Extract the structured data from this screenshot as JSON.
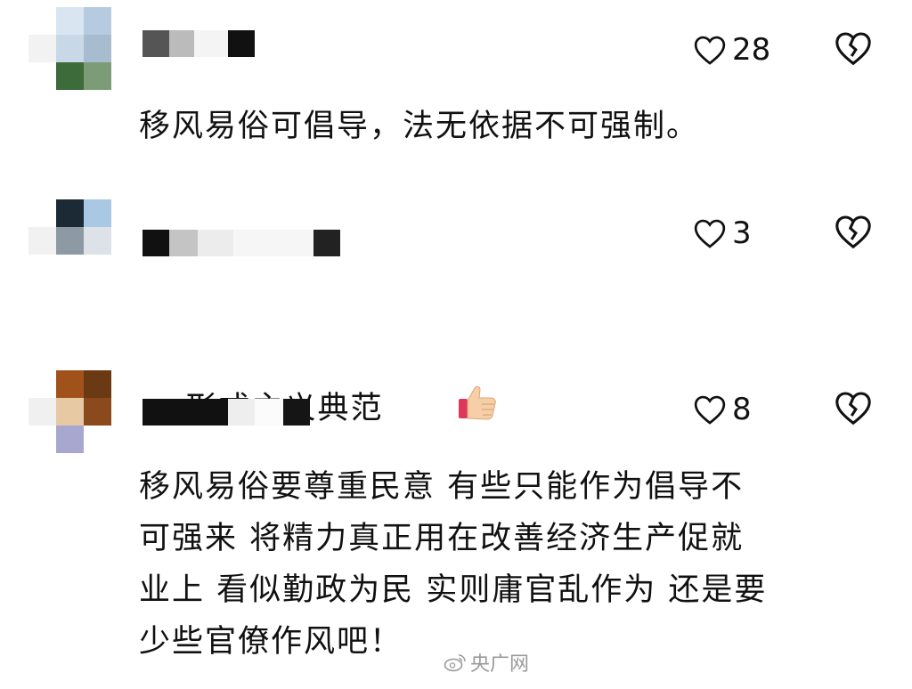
{
  "comments": [
    {
      "text": "移风易俗可倡导，法无依据不可强制。",
      "likes": "28",
      "icons": {
        "like": "heart-outline-icon",
        "dislike": "broken-heart-icon"
      }
    },
    {
      "text": "形式主义典范",
      "likes": "3",
      "emoji": "thumbs-up-icon",
      "icons": {
        "like": "heart-outline-icon",
        "dislike": "broken-heart-icon"
      }
    },
    {
      "text": "移风易俗要尊重民意 有些只能作为倡导不\n可强来 将精力真正用在改善经济生产促就\n业上 看似勤政为民 实则庸官乱作为 还是要\n少些官僚作风吧！",
      "likes": "8",
      "icons": {
        "like": "heart-outline-icon",
        "dislike": "broken-heart-icon"
      }
    }
  ],
  "watermark": {
    "label": "央广网",
    "icon": "weibo-logo-icon"
  },
  "colors": {
    "text": "#111111",
    "watermark": "#9a9a9a",
    "background": "#ffffff"
  }
}
